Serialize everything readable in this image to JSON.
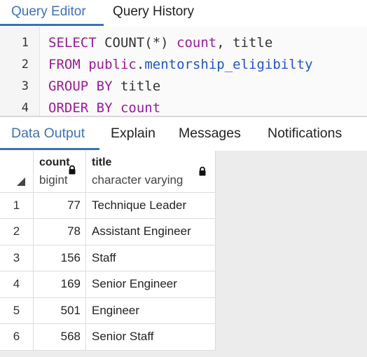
{
  "query_tabs": [
    "Query Editor",
    "Query History"
  ],
  "editor": {
    "line_numbers": [
      "1",
      "2",
      "3",
      "4"
    ],
    "lines": [
      {
        "kw1": "SELECT",
        "plain1": " COUNT(*) ",
        "kw2": "count",
        "plain2": ", title"
      },
      {
        "kw1": "FROM",
        "plain1": " ",
        "kw2": "public",
        "plain2": ".",
        "var": "mentorship_eligibilty"
      },
      {
        "kw1": "GROUP BY",
        "plain1": " title"
      },
      {
        "kw1": "ORDER BY",
        "plain1": " ",
        "kw2": "count"
      }
    ]
  },
  "output_tabs": [
    "Data Output",
    "Explain",
    "Messages",
    "Notifications"
  ],
  "grid": {
    "columns": [
      {
        "name": "count",
        "type": "bigint"
      },
      {
        "name": "title",
        "type": "character varying"
      }
    ],
    "rows": [
      {
        "n": "1",
        "count": "77",
        "title": "Technique Leader"
      },
      {
        "n": "2",
        "count": "78",
        "title": "Assistant Engineer"
      },
      {
        "n": "3",
        "count": "156",
        "title": "Staff"
      },
      {
        "n": "4",
        "count": "169",
        "title": "Senior Engineer"
      },
      {
        "n": "5",
        "count": "501",
        "title": "Engineer"
      },
      {
        "n": "6",
        "count": "568",
        "title": "Senior Staff"
      }
    ]
  },
  "icons": {
    "lock": "lock-icon",
    "sort": "sort-triangle-icon"
  },
  "colors": {
    "accent": "#3d72b5",
    "keyword": "#9b1a9b",
    "identifier": "#2253c4"
  }
}
